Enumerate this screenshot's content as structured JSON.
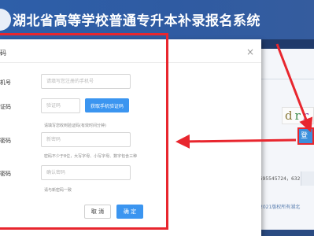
{
  "background": {
    "site_title": "湖北省高等学校普通专升本补录报名系统",
    "captcha_chars": [
      "d",
      "r",
      "r"
    ],
    "login_button_label": "登",
    "phone_text": "36，695545724，632",
    "copyright_text": "2021版权所有湖北"
  },
  "modal": {
    "title": "码",
    "close_label": "×",
    "fields": {
      "phone": {
        "label": "机号",
        "placeholder": "请填写您注册的手机号"
      },
      "code": {
        "label": "证码",
        "placeholder": "验证码",
        "button_label": "获取手机验证码",
        "hint": "请填写您收到验证码(有效时间分钟)"
      },
      "password": {
        "label": "密码",
        "placeholder": "新密码",
        "hint": "密码不少于8位，大写字母、小写字母、数字包含三种"
      },
      "confirm": {
        "label": "密码",
        "placeholder": "确认密码",
        "hint": "请与新密码一致"
      }
    },
    "cancel_label": "取 消",
    "ok_label": "确 定"
  },
  "colors": {
    "accent": "#3b95f0",
    "highlight": "#e8262e",
    "header": "#2e5fa9"
  }
}
